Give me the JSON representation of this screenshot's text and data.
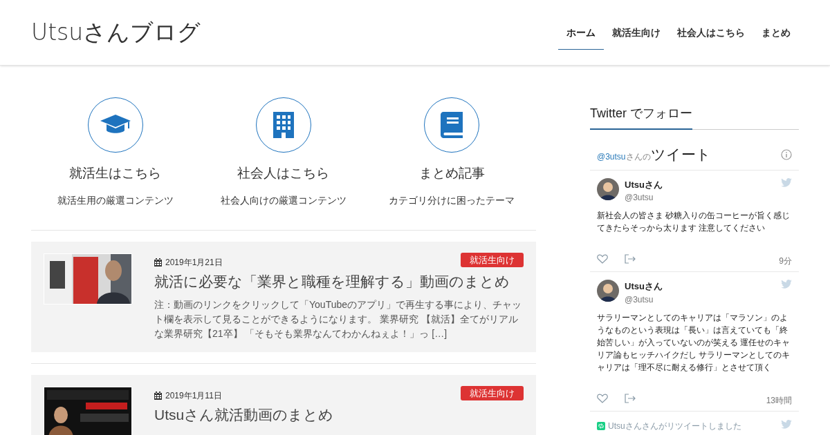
{
  "site_title": "Utsuさんブログ",
  "nav": [
    {
      "label": "ホーム",
      "selected": true
    },
    {
      "label": "就活生向け",
      "selected": false
    },
    {
      "label": "社会人はこちら",
      "selected": false
    },
    {
      "label": "まとめ",
      "selected": false
    }
  ],
  "features": [
    {
      "kind": "graduation",
      "title": "就活生はこちら",
      "description": "就活生用の厳選コンテンツ"
    },
    {
      "kind": "building",
      "title": "社会人はこちら",
      "description": "社会人向けの厳選コンテンツ"
    },
    {
      "kind": "book",
      "title": "まとめ記事",
      "description": "カテゴリ分けに困ったテーマ"
    }
  ],
  "posts": [
    {
      "date": "2019年1月21日",
      "category": "就活生向け",
      "title": "就活に必要な「業界と職種を理解する」動画のまとめ",
      "excerpt": "注：動画のリンクをクリックして「YouTubeのアプリ」で再生する事により、チャット欄を表示して見ることができるようになります。 業界研究 【就活】全てがリアルな業界研究【21卒】 「そもそも業界なんてわかんねぇよ！」っ […]"
    },
    {
      "date": "2019年1月11日",
      "category": "就活生向け",
      "title": "Utsuさん就活動画のまとめ"
    }
  ],
  "sidebar": {
    "heading": "Twitter でフォロー",
    "timeline": {
      "handle": "@3utsu",
      "handle_suffix": "さんの",
      "title": "ツイート",
      "tweets": [
        {
          "kind": "tweet",
          "name": "Utsuさん",
          "handle": "@3utsu",
          "text": "新社会人の皆さま 砂糖入りの缶コーヒーが旨く感じてきたらそっから太ります 注意してください",
          "time": "9分"
        },
        {
          "kind": "tweet",
          "name": "Utsuさん",
          "handle": "@3utsu",
          "text": "サラリーマンとしてのキャリアは「マラソン」のようなものという表現は「長い」は言えていても「終始苦しい」が入っていないのが笑える 運任せのキャリア論もヒッチハイクだし サラリーマンとしてのキャリアは「理不尽に耐える修行」とさせて頂く",
          "time": "13時間"
        },
        {
          "kind": "retweet",
          "text": "Utsuさんさんがリツイートしました"
        }
      ]
    }
  }
}
